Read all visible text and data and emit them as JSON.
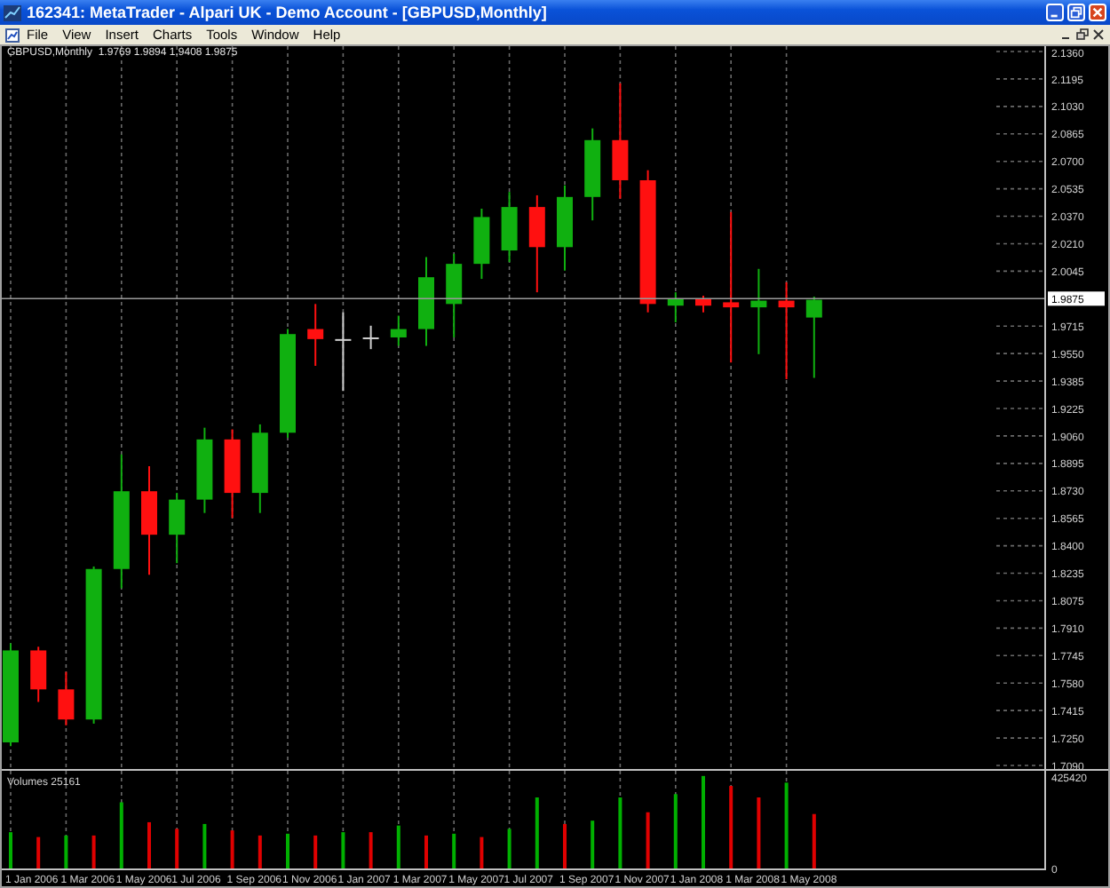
{
  "window": {
    "title": "162341: MetaTrader - Alpari UK - Demo Account - [GBPUSD,Monthly]"
  },
  "menu": [
    "File",
    "View",
    "Insert",
    "Charts",
    "Tools",
    "Window",
    "Help"
  ],
  "chart": {
    "header": "GBPUSD,Monthly  1.9769 1.9894 1.9408 1.9875",
    "price_axis": [
      "2.1360",
      "2.1195",
      "2.1030",
      "2.0865",
      "2.0700",
      "2.0535",
      "2.0370",
      "2.0210",
      "2.0045",
      "1.9715",
      "1.9550",
      "1.9385",
      "1.9225",
      "1.9060",
      "1.8895",
      "1.8730",
      "1.8565",
      "1.8400",
      "1.8235",
      "1.8075",
      "1.7910",
      "1.7745",
      "1.7580",
      "1.7415",
      "1.7250",
      "1.7090"
    ],
    "bid_price": "1.9875"
  },
  "volume": {
    "label": "Volumes 25161",
    "axis": [
      "425420",
      "0"
    ]
  },
  "time_axis": [
    "1 Jan 2006",
    "1 Mar 2006",
    "1 May 2006",
    "1 Jul 2006",
    "1 Sep 2006",
    "1 Nov 2006",
    "1 Jan 2007",
    "1 Mar 2007",
    "1 May 2007",
    "1 Jul 2007",
    "1 Sep 2007",
    "1 Nov 2007",
    "1 Jan 2008",
    "1 Mar 2008",
    "1 May 2008"
  ]
}
